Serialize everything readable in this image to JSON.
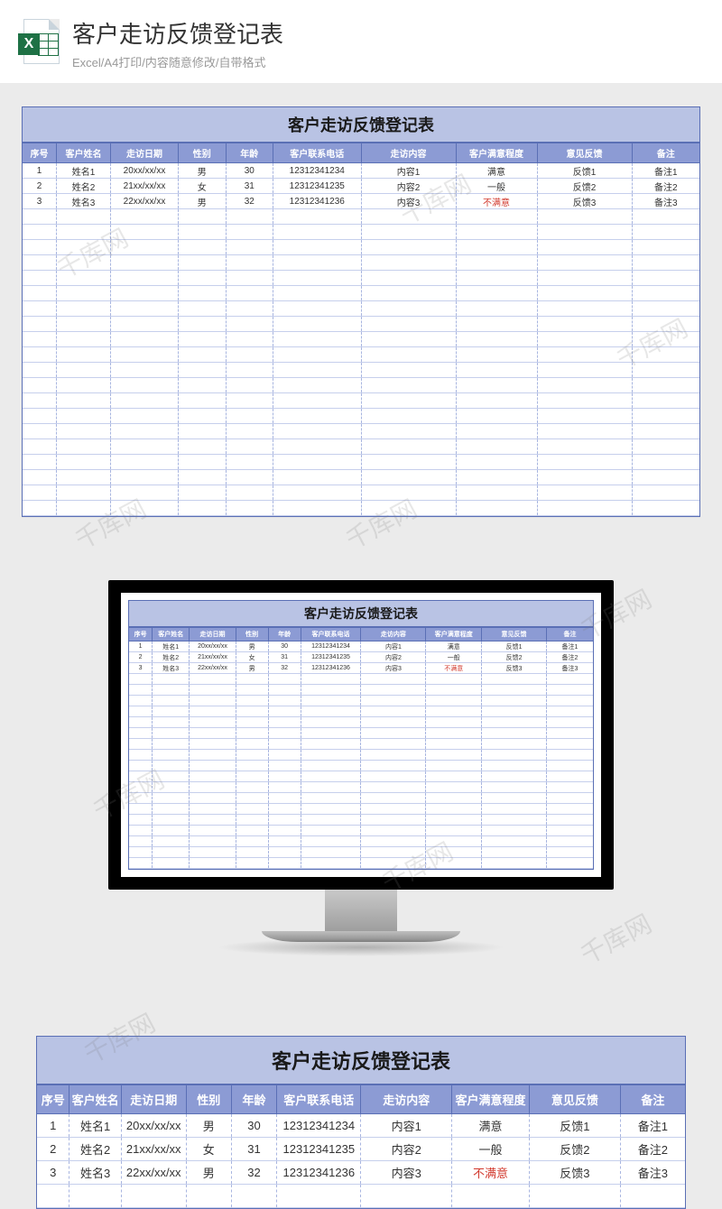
{
  "header": {
    "title": "客户走访反馈登记表",
    "subtitle": "Excel/A4打印/内容随意修改/自带格式"
  },
  "watermark": "千库网",
  "sheet": {
    "title": "客户走访反馈登记表",
    "columns": [
      "序号",
      "客户姓名",
      "走访日期",
      "性别",
      "年龄",
      "客户联系电话",
      "走访内容",
      "客户满意程度",
      "意见反馈",
      "备注"
    ],
    "rows": [
      {
        "seq": "1",
        "name": "姓名1",
        "date": "20xx/xx/xx",
        "gender": "男",
        "age": "30",
        "phone": "12312341234",
        "content": "内容1",
        "satisfy": "满意",
        "satisfy_red": false,
        "feedback": "反馈1",
        "remark": "备注1"
      },
      {
        "seq": "2",
        "name": "姓名2",
        "date": "21xx/xx/xx",
        "gender": "女",
        "age": "31",
        "phone": "12312341235",
        "content": "内容2",
        "satisfy": "一般",
        "satisfy_red": false,
        "feedback": "反馈2",
        "remark": "备注2"
      },
      {
        "seq": "3",
        "name": "姓名3",
        "date": "22xx/xx/xx",
        "gender": "男",
        "age": "32",
        "phone": "12312341236",
        "content": "内容3",
        "satisfy": "不满意",
        "satisfy_red": true,
        "feedback": "反馈3",
        "remark": "备注3"
      }
    ],
    "empty_rows_large": 20,
    "empty_rows_small": 18
  }
}
